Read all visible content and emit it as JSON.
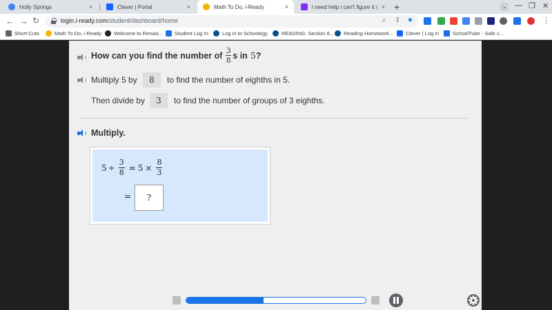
{
  "browser": {
    "tabs": [
      {
        "title": "Holly Springs",
        "color": "#4285f4",
        "active": false
      },
      {
        "title": "Clever | Portal",
        "color": "#1464ff",
        "active": false
      },
      {
        "title": "Math To Do, i-Ready",
        "color": "#f4b400",
        "active": true
      },
      {
        "title": "i need help i can't figure it out lo",
        "color": "#7b2ff7",
        "active": false
      }
    ],
    "close_glyph": "×",
    "new_tab_glyph": "+",
    "tab_menu_glyph": "⌄",
    "window_controls": [
      "—",
      "❐",
      "✕"
    ],
    "url_host": "login.i-ready.com",
    "url_path": "/student/dashboard/home",
    "bookmarks": [
      {
        "label": "Short-Cuts",
        "icon": "folder-icon",
        "color": "#5f6368"
      },
      {
        "label": "Math To Do, i-Ready",
        "icon": "iready-icon",
        "color": "#f4b400"
      },
      {
        "label": "Welcome to Renais...",
        "icon": "renaissance-icon",
        "color": "#202124"
      },
      {
        "label": "Student Log In",
        "icon": "student-login-icon",
        "color": "#1a73e8"
      },
      {
        "label": "Log in to Schoology",
        "icon": "schoology-icon",
        "color": "#0c4f8a"
      },
      {
        "label": "READING: Section 8...",
        "icon": "schoology-icon",
        "color": "#0c4f8a"
      },
      {
        "label": "Reading Homework...",
        "icon": "schoology-icon",
        "color": "#0c4f8a"
      },
      {
        "label": "Clever | Log in",
        "icon": "clever-icon",
        "color": "#1464ff"
      },
      {
        "label": "SchoolTube - Safe v...",
        "icon": "schooltube-icon",
        "color": "#1a73e8"
      }
    ]
  },
  "lesson": {
    "question": {
      "prefix": "How can you find the number of",
      "frac_num": "3",
      "frac_den": "8",
      "suffix_s": "s in",
      "number": "5",
      "qmark": "?"
    },
    "step1": {
      "before": "Multiply 5 by",
      "value": "8",
      "after": "to find the number of eighths in 5."
    },
    "step2": {
      "before": "Then divide by",
      "value": "3",
      "after": "to find the number of groups of 3 eighths."
    },
    "multiply_label": "Multiply.",
    "equation": {
      "left_num": "5",
      "div_sign": "÷",
      "frac1_num": "3",
      "frac1_den": "8",
      "equals": "=",
      "right_num": "5",
      "times_sign": "×",
      "frac2_num": "8",
      "frac2_den": "3"
    },
    "answer_placeholder": "?",
    "progress_fraction": 0.43
  },
  "colors": {
    "accent": "#1a73e8",
    "panel": "#d6e8fb"
  }
}
